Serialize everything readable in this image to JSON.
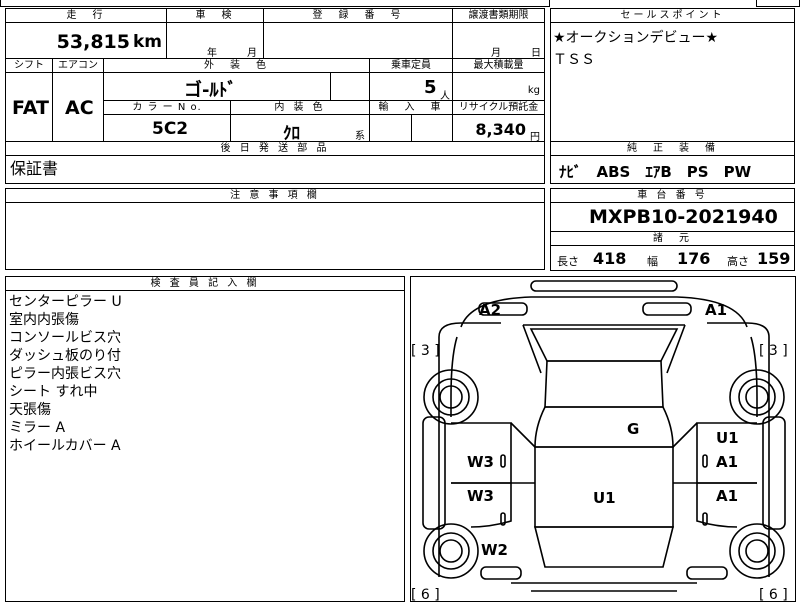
{
  "header_labels": {
    "mileage": "走　行",
    "inspection": "車　検",
    "registration": "登　録　番　号",
    "transfer_deadline": "譲渡書類期限",
    "selling_points": "セールスポイント",
    "shift": "シフト",
    "aircon": "エアコン",
    "exterior_color": "外　装　色",
    "capacity": "乗車定員",
    "max_load": "最大積載量",
    "color_no": "カ ラ ー N o.",
    "interior_color": "内 装 色",
    "import": "輸　入　車",
    "recycle": "リサイクル預託金",
    "later_parts": "後 日 発 送 部 品",
    "equipment": "純　正　装　備",
    "notes": "注 意 事 項 欄",
    "chassis_no": "車 台 番 号",
    "specs": "諸　元",
    "inspector": "検 査 員 記 入 欄"
  },
  "mileage": {
    "value": "53,815",
    "unit": "km"
  },
  "inspection": {
    "year": "年",
    "month": "月"
  },
  "transfer": {
    "month": "月",
    "day": "日"
  },
  "shift": "FAT",
  "aircon": "AC",
  "exterior_color": "ゴ-ﾙﾄﾞ",
  "capacity": {
    "value": "5",
    "unit": "人"
  },
  "max_load": {
    "unit": "kg"
  },
  "color_no": "5C2",
  "interior_color": {
    "value": "ｸﾛ",
    "suffix": "系"
  },
  "recycle": {
    "value": "8,340",
    "unit": "円"
  },
  "selling_points": [
    "★オークションデビュー★",
    "ＴＳＳ"
  ],
  "later_parts": "保証書",
  "equipment": "ﾅﾋﾞ　ABS　ｴｱB　PS　PW",
  "chassis_no": "MXPB10-2021940",
  "specs": {
    "length_label": "長さ",
    "length": "418",
    "width_label": "幅",
    "width": "176",
    "height_label": "高さ",
    "height": "159"
  },
  "inspector_notes": [
    "センターピラー U",
    "室内内張傷",
    "コンソールビス穴",
    "ダッシュ板のり付",
    "ピラー内張ビス穴",
    "シート すれ中",
    "天張傷",
    "ミラー A",
    "ホイールカバー A"
  ],
  "diagram_marks": {
    "front_left": "A2",
    "front_right": "A1",
    "tire_front_left": "[ 3 ]",
    "tire_front_right": "[ 3 ]",
    "tire_rear_left": "[ 6 ]",
    "tire_rear_right": "[ 6 ]",
    "roof": "G",
    "right_front_door_upper": "U1",
    "right_front_door_lower": "A1",
    "right_rear_door": "A1",
    "left_front_door": "W3",
    "left_rear_door": "W3",
    "left_rear_fender": "W2",
    "rear_roof": "U1"
  }
}
